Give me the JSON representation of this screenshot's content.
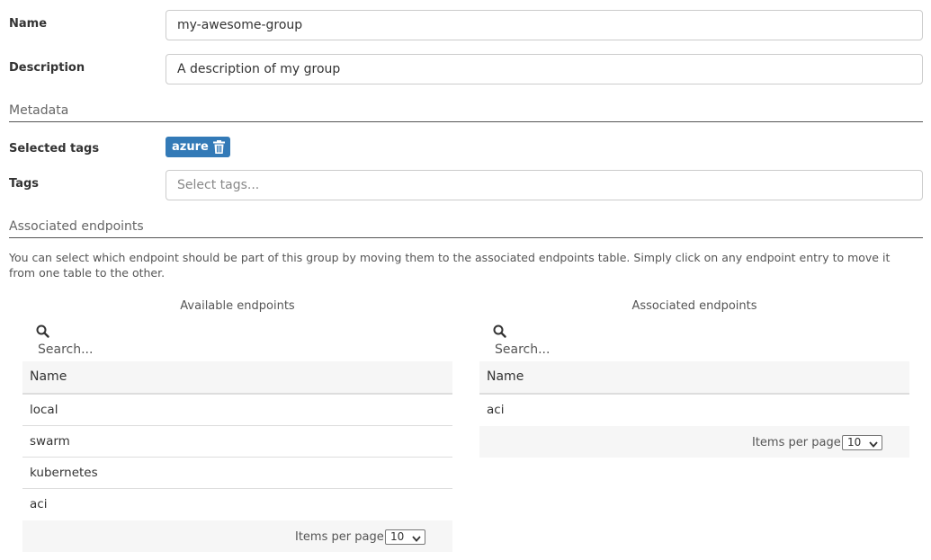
{
  "form": {
    "name_label": "Name",
    "name_value": "my-awesome-group",
    "description_label": "Description",
    "description_value": "A description of my group"
  },
  "metadata": {
    "section_title": "Metadata",
    "selected_tags_label": "Selected tags",
    "selected_tags": [
      "azure"
    ],
    "tags_label": "Tags",
    "tags_placeholder": "Select tags..."
  },
  "endpoints": {
    "section_title": "Associated endpoints",
    "help_text": "You can select which endpoint should be part of this group by moving them to the associated endpoints table. Simply click on any endpoint entry to move it from one table to the other.",
    "available": {
      "title": "Available endpoints",
      "search_placeholder": "Search...",
      "column_header": "Name",
      "rows": [
        "local",
        "swarm",
        "kubernetes",
        "aci"
      ],
      "items_per_page_label": "Items per page",
      "items_per_page_value": "10"
    },
    "associated": {
      "title": "Associated endpoints",
      "search_placeholder": "Search...",
      "column_header": "Name",
      "rows": [
        "aci"
      ],
      "items_per_page_label": "Items per page",
      "items_per_page_value": "10"
    }
  },
  "colors": {
    "tag_badge": "#337ab7",
    "table_header_bg": "#f6f6f6",
    "border": "#cccccc"
  }
}
